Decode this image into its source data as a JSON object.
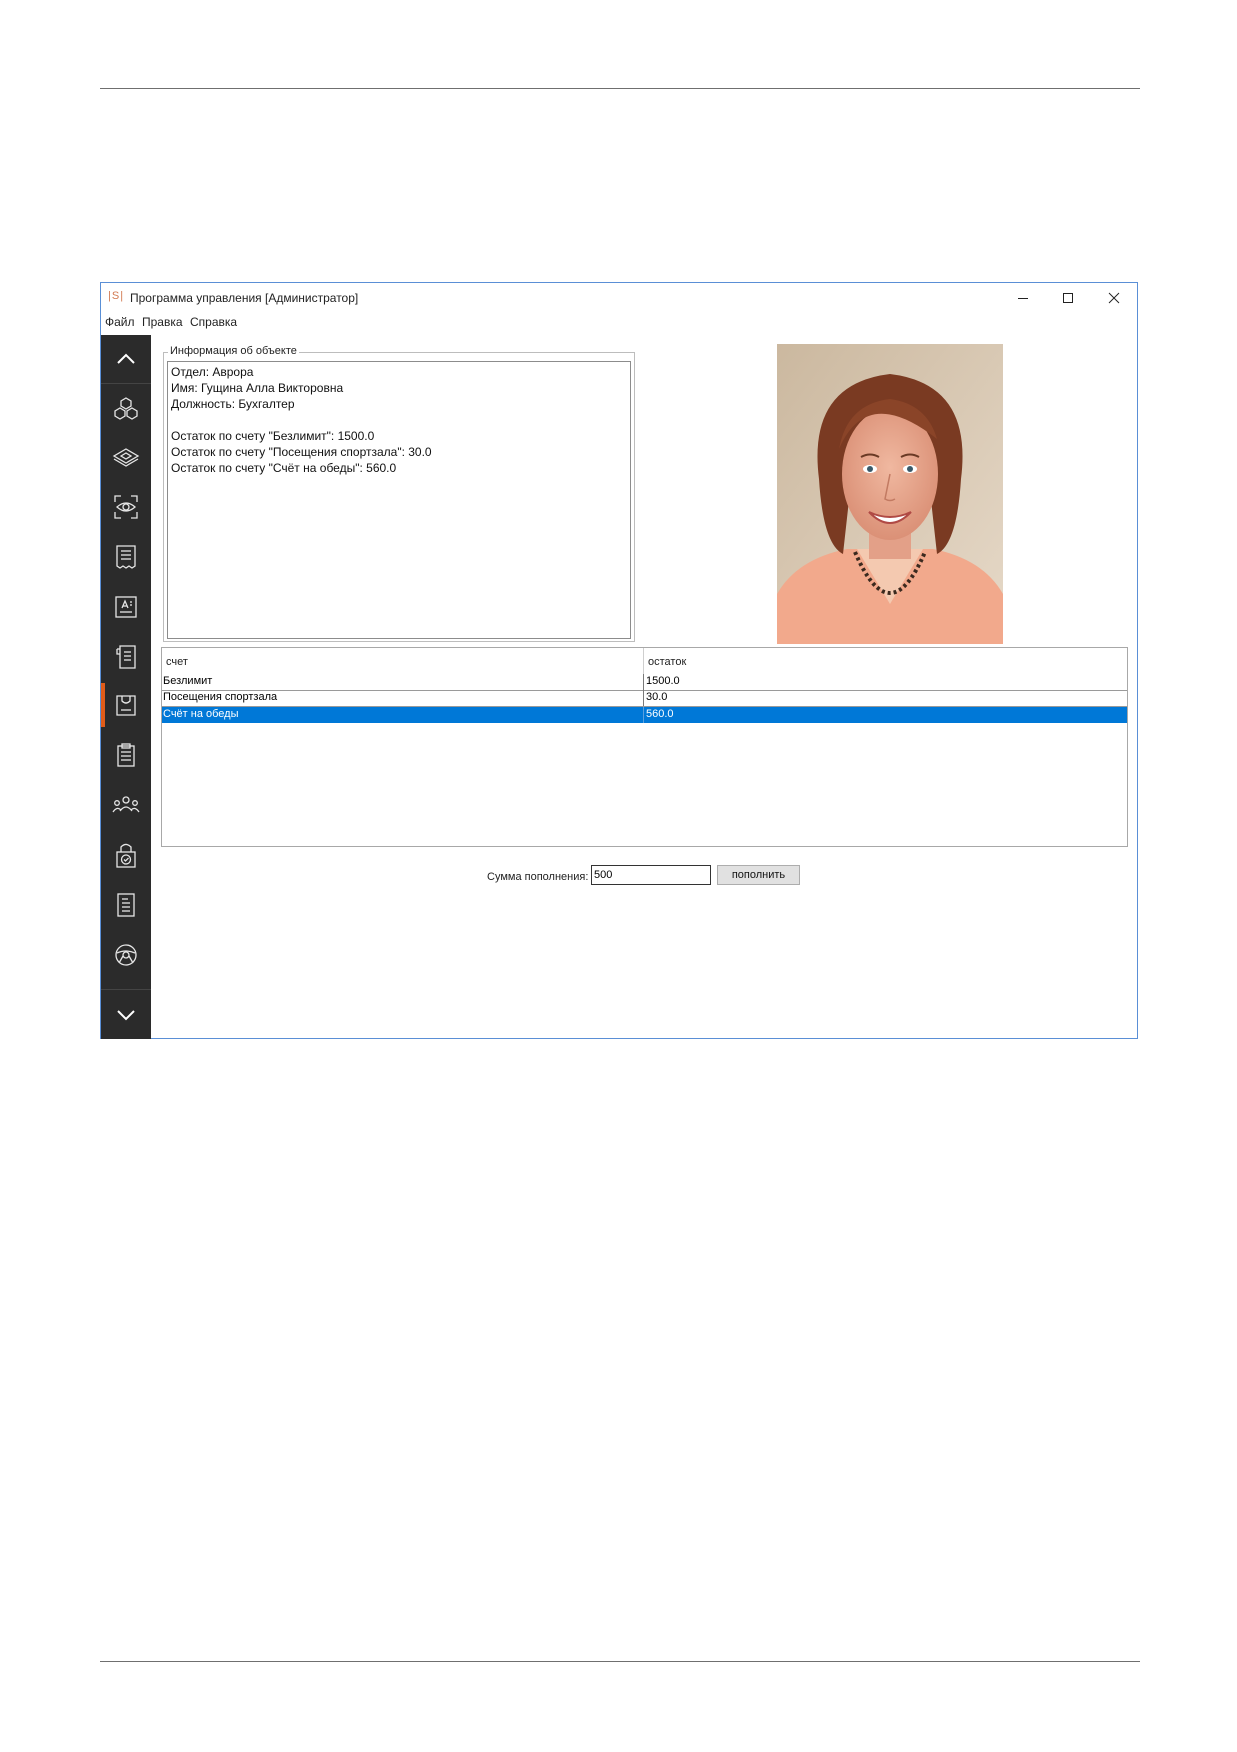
{
  "window": {
    "logo_text": "|S|",
    "title": "Программа управления [Администратор]"
  },
  "menu": [
    "Файл",
    "Правка",
    "Справка"
  ],
  "sidebar": {
    "items": [
      {
        "icon": "chevron-up-icon"
      },
      {
        "icon": "cubes-icon"
      },
      {
        "icon": "layers-icon"
      },
      {
        "icon": "eye-scan-icon"
      },
      {
        "icon": "receipt-icon"
      },
      {
        "icon": "id-card-icon"
      },
      {
        "icon": "document-list-icon"
      },
      {
        "icon": "bag-icon",
        "active": true
      },
      {
        "icon": "clipboard-icon"
      },
      {
        "icon": "people-icon"
      },
      {
        "icon": "lock-check-icon"
      },
      {
        "icon": "text-document-icon"
      },
      {
        "icon": "steering-wheel-icon"
      },
      {
        "icon": "chevron-down-icon"
      }
    ],
    "accent_color": "#e05c1a",
    "background_color": "#2b2b2b"
  },
  "info": {
    "legend": "Информация об объекте",
    "lines": [
      "Отдел: Аврора",
      "Имя: Гущина Алла Викторовна",
      "Должность: Бухгалтер",
      "",
      "Остаток по счету \"Безлимит\": 1500.0",
      "Остаток по счету \"Посещения спортзала\": 30.0",
      "Остаток по счету \"Счёт на обеды\": 560.0"
    ]
  },
  "table": {
    "columns": [
      "счет",
      "остаток"
    ],
    "rows": [
      [
        "Безлимит",
        "1500.0"
      ],
      [
        "Посещения спортзала",
        "30.0"
      ],
      [
        "Счёт на обеды",
        "560.0"
      ]
    ],
    "selected_row": 2,
    "selection_color": "#0078d7"
  },
  "topup": {
    "label": "Сумма пополнения:",
    "value": "500",
    "button_label": "пополнить"
  }
}
